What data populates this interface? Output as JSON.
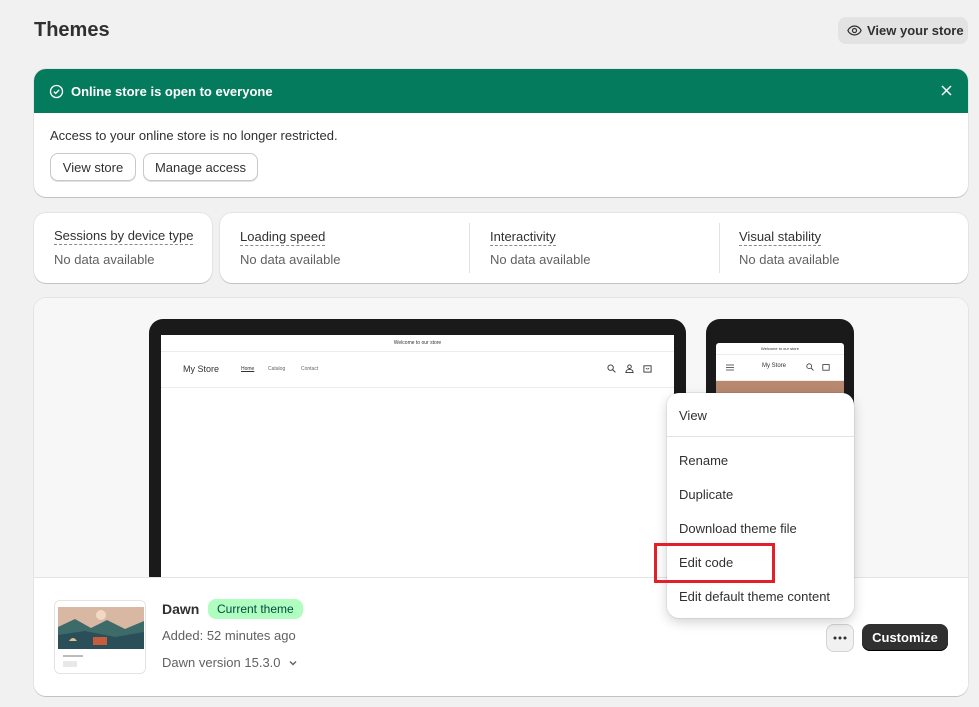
{
  "page": {
    "title": "Themes",
    "view_store_button": "View your store"
  },
  "banner": {
    "title": "Online store is open to everyone",
    "message": "Access to your online store is no longer restricted.",
    "buttons": {
      "view_store": "View store",
      "manage_access": "Manage access"
    },
    "accent_color": "#047b5d"
  },
  "metrics": {
    "sessions": {
      "label": "Sessions by device type",
      "value": "No data available"
    },
    "loading_speed": {
      "label": "Loading speed",
      "value": "No data available"
    },
    "interactivity": {
      "label": "Interactivity",
      "value": "No data available"
    },
    "visual_stability": {
      "label": "Visual stability",
      "value": "No data available"
    }
  },
  "preview": {
    "announcement": "Welcome to our store",
    "store_name": "My Store",
    "nav": [
      "Home",
      "Catalog",
      "Contact"
    ]
  },
  "theme": {
    "name": "Dawn",
    "badge": "Current theme",
    "added": "Added: 52 minutes ago",
    "version": "Dawn version 15.3.0",
    "customize_button": "Customize"
  },
  "menu": {
    "items": [
      "View",
      "Rename",
      "Duplicate",
      "Download theme file",
      "Edit code",
      "Edit default theme content"
    ],
    "highlighted": "Edit code"
  }
}
